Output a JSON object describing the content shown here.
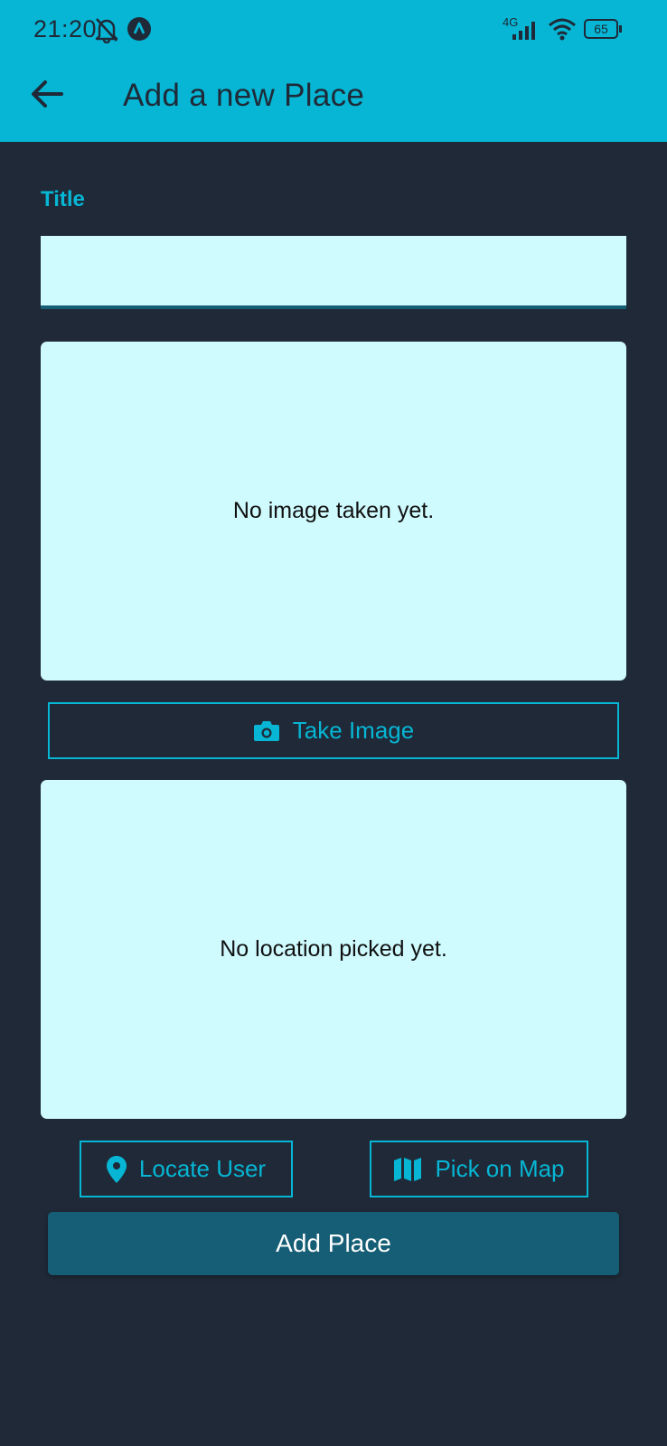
{
  "status_bar": {
    "time": "21:20",
    "network": "4G",
    "battery": "65",
    "icons": [
      "bell-off-icon",
      "app-notification-icon",
      "signal-icon",
      "wifi-icon",
      "battery-icon"
    ]
  },
  "toolbar": {
    "title": "Add a new Place",
    "back_icon": "arrow-back-icon"
  },
  "form": {
    "title_label": "Title",
    "title_value": "",
    "image_preview_text": "No image taken yet.",
    "take_image_label": "Take Image",
    "take_image_icon": "camera-icon",
    "location_preview_text": "No location picked yet.",
    "locate_user_label": "Locate User",
    "locate_user_icon": "location-pin-icon",
    "pick_on_map_label": "Pick on Map",
    "pick_on_map_icon": "map-icon",
    "add_place_label": "Add Place"
  },
  "colors": {
    "app_bar": "#06b6d4",
    "background": "#1f2937",
    "accent": "#06b6d4",
    "surface": "#cffafe",
    "primary_button": "#155e75"
  }
}
